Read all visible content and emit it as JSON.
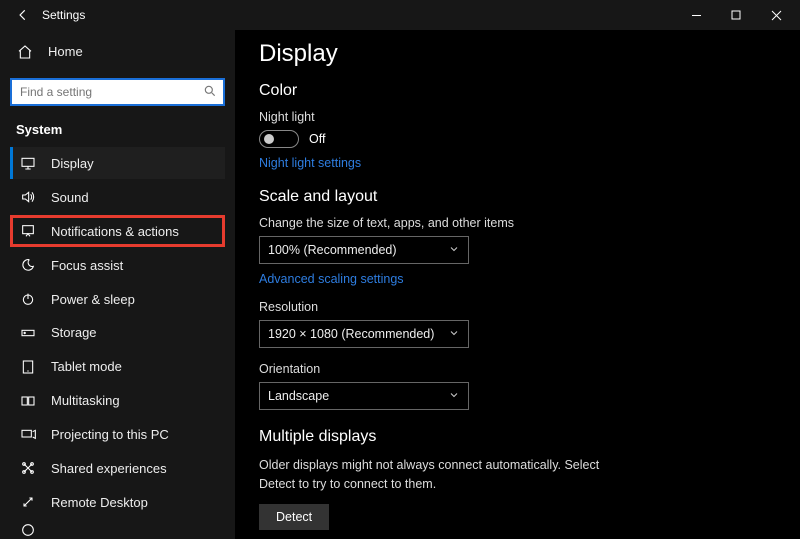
{
  "titlebar": {
    "title": "Settings"
  },
  "sidebar": {
    "home_label": "Home",
    "search_placeholder": "Find a setting",
    "section_header": "System",
    "items": [
      {
        "label": "Display"
      },
      {
        "label": "Sound"
      },
      {
        "label": "Notifications & actions"
      },
      {
        "label": "Focus assist"
      },
      {
        "label": "Power & sleep"
      },
      {
        "label": "Storage"
      },
      {
        "label": "Tablet mode"
      },
      {
        "label": "Multitasking"
      },
      {
        "label": "Projecting to this PC"
      },
      {
        "label": "Shared experiences"
      },
      {
        "label": "Remote Desktop"
      }
    ]
  },
  "main": {
    "page_title": "Display",
    "color": {
      "heading": "Color",
      "night_light_label": "Night light",
      "night_light_state": "Off",
      "night_light_settings_link": "Night light settings"
    },
    "scale": {
      "heading": "Scale and layout",
      "size_label": "Change the size of text, apps, and other items",
      "size_value": "100% (Recommended)",
      "advanced_link": "Advanced scaling settings",
      "resolution_label": "Resolution",
      "resolution_value": "1920 × 1080 (Recommended)",
      "orientation_label": "Orientation",
      "orientation_value": "Landscape"
    },
    "multi": {
      "heading": "Multiple displays",
      "body": "Older displays might not always connect automatically. Select Detect to try to connect to them.",
      "detect_label": "Detect"
    }
  }
}
